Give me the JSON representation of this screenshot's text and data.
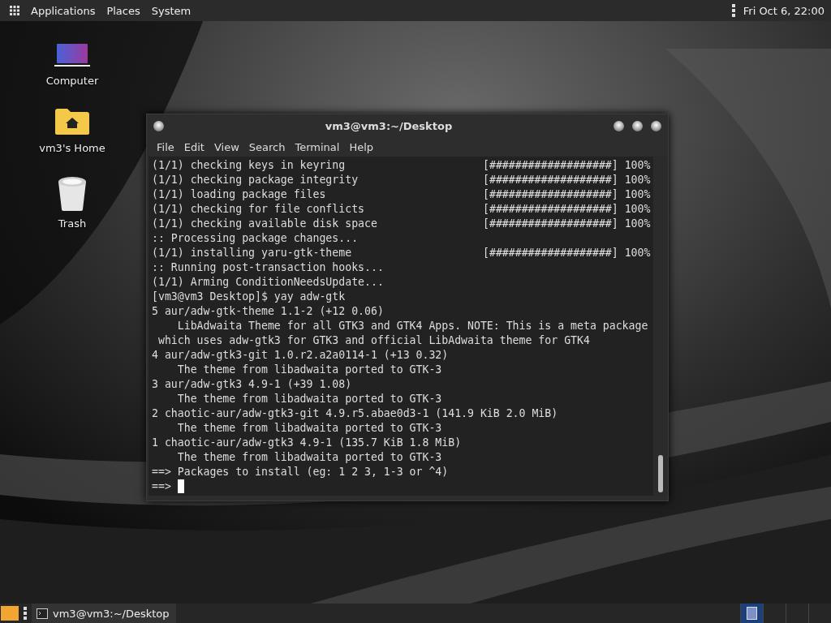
{
  "top_panel": {
    "menus": [
      "Applications",
      "Places",
      "System"
    ],
    "clock": "Fri Oct  6, 22:00"
  },
  "desktop_icons": [
    {
      "kind": "computer",
      "label": "Computer"
    },
    {
      "kind": "home",
      "label": "vm3's Home"
    },
    {
      "kind": "trash",
      "label": "Trash"
    }
  ],
  "terminal": {
    "title": "vm3@vm3:~/Desktop",
    "menu": [
      "File",
      "Edit",
      "View",
      "Search",
      "Terminal",
      "Help"
    ],
    "lines": [
      {
        "text": "(1/1) checking keys in keyring",
        "status": "[###################] 100%"
      },
      {
        "text": "(1/1) checking package integrity",
        "status": "[###################] 100%"
      },
      {
        "text": "(1/1) loading package files",
        "status": "[###################] 100%"
      },
      {
        "text": "(1/1) checking for file conflicts",
        "status": "[###################] 100%"
      },
      {
        "text": "(1/1) checking available disk space",
        "status": "[###################] 100%"
      },
      {
        "text": ":: Processing package changes..."
      },
      {
        "text": "(1/1) installing yaru-gtk-theme",
        "status": "[###################] 100%"
      },
      {
        "text": ":: Running post-transaction hooks..."
      },
      {
        "text": "(1/1) Arming ConditionNeedsUpdate..."
      },
      {
        "text": "[vm3@vm3 Desktop]$ yay adw-gtk"
      },
      {
        "text": "5 aur/adw-gtk-theme 1.1-2 (+12 0.06)"
      },
      {
        "text": "    LibAdwaita Theme for all GTK3 and GTK4 Apps. NOTE: This is a meta package"
      },
      {
        "text": " which uses adw-gtk3 for GTK3 and official LibAdwaita theme for GTK4"
      },
      {
        "text": "4 aur/adw-gtk3-git 1.0.r2.a2a0114-1 (+13 0.32)"
      },
      {
        "text": "    The theme from libadwaita ported to GTK-3"
      },
      {
        "text": "3 aur/adw-gtk3 4.9-1 (+39 1.08)"
      },
      {
        "text": "    The theme from libadwaita ported to GTK-3"
      },
      {
        "text": "2 chaotic-aur/adw-gtk3-git 4.9.r5.abae0d3-1 (141.9 KiB 2.0 MiB)"
      },
      {
        "text": "    The theme from libadwaita ported to GTK-3"
      },
      {
        "text": "1 chaotic-aur/adw-gtk3 4.9-1 (135.7 KiB 1.8 MiB)"
      },
      {
        "text": "    The theme from libadwaita ported to GTK-3"
      },
      {
        "text": "==> Packages to install (eg: 1 2 3, 1-3 or ^4)"
      },
      {
        "text": "==> ",
        "cursor": true
      }
    ]
  },
  "taskbar": {
    "tasks": [
      {
        "label": "vm3@vm3:~/Desktop",
        "selected": false
      }
    ],
    "workspaces": [
      {
        "selected": true
      },
      {
        "selected": false
      },
      {
        "selected": false
      },
      {
        "selected": false
      }
    ]
  }
}
